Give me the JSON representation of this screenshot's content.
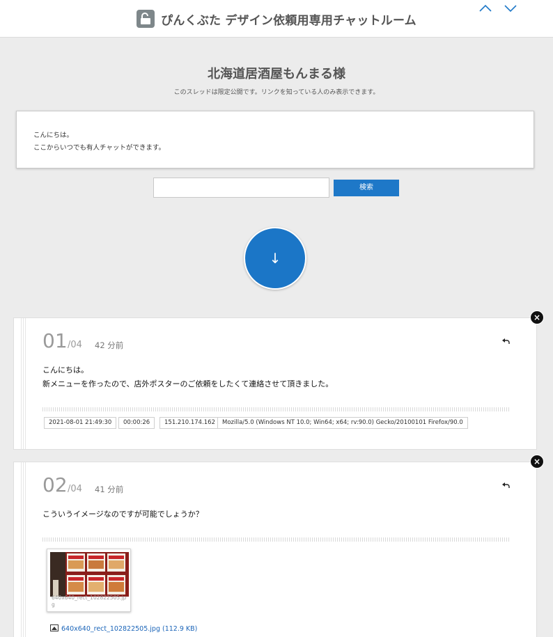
{
  "header": {
    "site_title": "ぴんくぶた デザイン依頼用専用チャットルーム",
    "nav_up_icon": "chevron-up-icon",
    "nav_down_icon": "chevron-down-icon"
  },
  "thread": {
    "title": "北海道居酒屋もんまる様",
    "visibility_note": "このスレッドは限定公開です。リンクを知っている人のみ表示できます。",
    "intro_lines": [
      "こんにちは。",
      "ここからいつでも有人チャットができます。"
    ]
  },
  "search": {
    "value": "",
    "button_label": "検索"
  },
  "scroll_down_label": "↓",
  "posts": [
    {
      "number": "01",
      "total": "/04",
      "ago": "42 分前",
      "lines": [
        "こんにちは。",
        "新メニューを作ったので、店外ポスターのご依頼をしたくて連絡させて頂きました。"
      ],
      "meta": [
        "2021-08-01 21:49:30",
        "00:00:26",
        "151.210.174.162",
        "Mozilla/5.0 (Windows NT 10.0; Win64; x64; rv:90.0) Gecko/20100101 Firefox/90.0"
      ]
    },
    {
      "number": "02",
      "total": "/04",
      "ago": "41 分前",
      "lines": [
        "こういうイメージなのですが可能でしょうか？"
      ],
      "attachment": {
        "caption": "640x640_rect_102822505.jpg",
        "link_text": "640x640_rect_102822505.jpg (112.9 KB)"
      }
    }
  ],
  "close_label": "×",
  "colors": {
    "accent": "#1e78c8",
    "background": "#ececec"
  }
}
